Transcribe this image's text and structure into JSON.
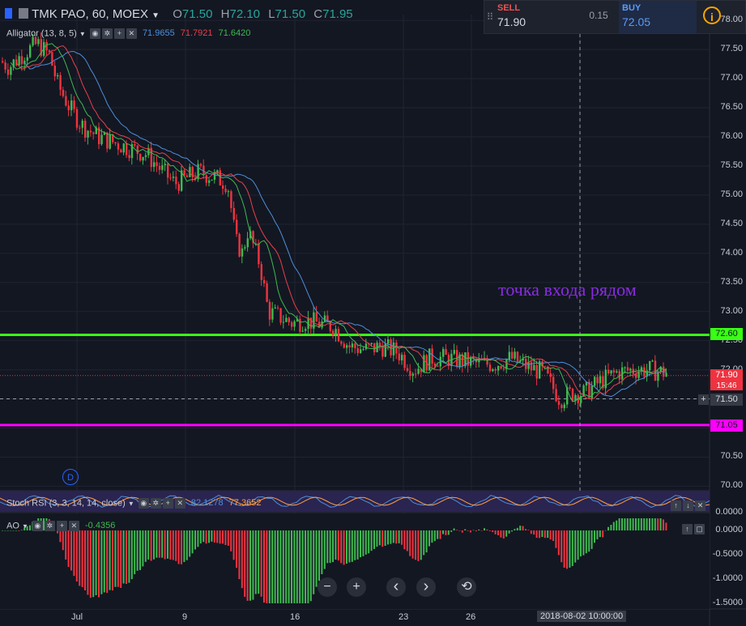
{
  "header": {
    "symbol": "TMK PAO, 60, MOEX",
    "open_label": "O",
    "open": "71.50",
    "high_label": "H",
    "high": "72.10",
    "low_label": "L",
    "low": "71.50",
    "close_label": "C",
    "close": "71.95"
  },
  "alligator": {
    "label": "Alligator (13, 8, 5)",
    "jaw": "71.9655",
    "teeth": "71.7921",
    "lips": "71.6420",
    "jaw_color": "#4d8fd9",
    "teeth_color": "#e8404b",
    "lips_color": "#3fb950"
  },
  "trade_panel": {
    "sell_label": "SELL",
    "sell_price": "71.90",
    "spread": "0.15",
    "buy_label": "BUY",
    "buy_price": "72.05",
    "info_icon": "info-icon"
  },
  "price_axis": {
    "ticks": [
      "78.00",
      "77.50",
      "77.00",
      "76.50",
      "76.00",
      "75.50",
      "75.00",
      "74.50",
      "74.00",
      "73.50",
      "73.00",
      "72.50",
      "72.00",
      "71.50",
      "71.00",
      "70.50",
      "70.00"
    ],
    "tag_green": "72.60",
    "tag_red": "71.90",
    "tag_time": "15:46",
    "tag_cross": "71.50",
    "tag_magenta": "71.05"
  },
  "annotation": {
    "text": "точка входа рядом",
    "color": "#8a2be2"
  },
  "levels": {
    "green_color": "#39ff14",
    "magenta_color": "#ff00ff"
  },
  "stoch": {
    "label": "Stoch RSI (3, 3, 14, 14, close)",
    "k": "82.1278",
    "d": "77.3652",
    "k_color": "#4d8fd9",
    "d_color": "#ff9f43",
    "axis_tick": "0.0000"
  },
  "ao": {
    "label": "AO",
    "value": "-0.4356",
    "ticks": [
      "0.0000",
      "-0.5000",
      "-1.0000",
      "-1.5000"
    ]
  },
  "time_axis": {
    "labels": [
      "Jul",
      "9",
      "16",
      "23",
      "26",
      "6"
    ],
    "cursor_label": "2018-08-02 10:00:00"
  },
  "dividend_marker": "D",
  "nav": {
    "zoom_out": "−",
    "zoom_in": "+",
    "scroll_left": "‹",
    "scroll_right": "›",
    "reset": "⟲"
  },
  "chart_data": {
    "type": "candlestick",
    "ylim": [
      69.95,
      78.1
    ],
    "horizontal_levels": [
      72.6,
      71.05
    ],
    "current_price": 71.9,
    "cursor_price": 71.5,
    "keypoints": [
      [
        0,
        77.3
      ],
      [
        10,
        77.2
      ],
      [
        25,
        77.4
      ],
      [
        45,
        77.6
      ],
      [
        60,
        77.4
      ],
      [
        70,
        76.9
      ],
      [
        85,
        76.5
      ],
      [
        100,
        76.2
      ],
      [
        120,
        76.0
      ],
      [
        140,
        75.9
      ],
      [
        160,
        75.8
      ],
      [
        180,
        75.7
      ],
      [
        200,
        75.4
      ],
      [
        215,
        75.2
      ],
      [
        230,
        75.3
      ],
      [
        245,
        75.4
      ],
      [
        265,
        75.3
      ],
      [
        280,
        75.2
      ],
      [
        290,
        74.2
      ],
      [
        298,
        74.0
      ],
      [
        305,
        74.4
      ],
      [
        320,
        73.8
      ],
      [
        330,
        73.0
      ],
      [
        345,
        72.9
      ],
      [
        360,
        72.8
      ],
      [
        375,
        72.85
      ],
      [
        390,
        72.8
      ],
      [
        410,
        72.75
      ],
      [
        430,
        72.4
      ],
      [
        450,
        72.35
      ],
      [
        470,
        72.4
      ],
      [
        490,
        72.3
      ],
      [
        510,
        72.0
      ],
      [
        530,
        72.2
      ],
      [
        550,
        72.2
      ],
      [
        570,
        72.15
      ],
      [
        590,
        72.1
      ],
      [
        610,
        72.1
      ],
      [
        630,
        72.2
      ],
      [
        650,
        72.05
      ],
      [
        670,
        71.95
      ],
      [
        690,
        71.5
      ],
      [
        705,
        71.6
      ],
      [
        720,
        71.6
      ],
      [
        740,
        71.8
      ],
      [
        760,
        71.95
      ],
      [
        780,
        72.0
      ],
      [
        800,
        72.0
      ],
      [
        820,
        71.95
      ]
    ]
  }
}
